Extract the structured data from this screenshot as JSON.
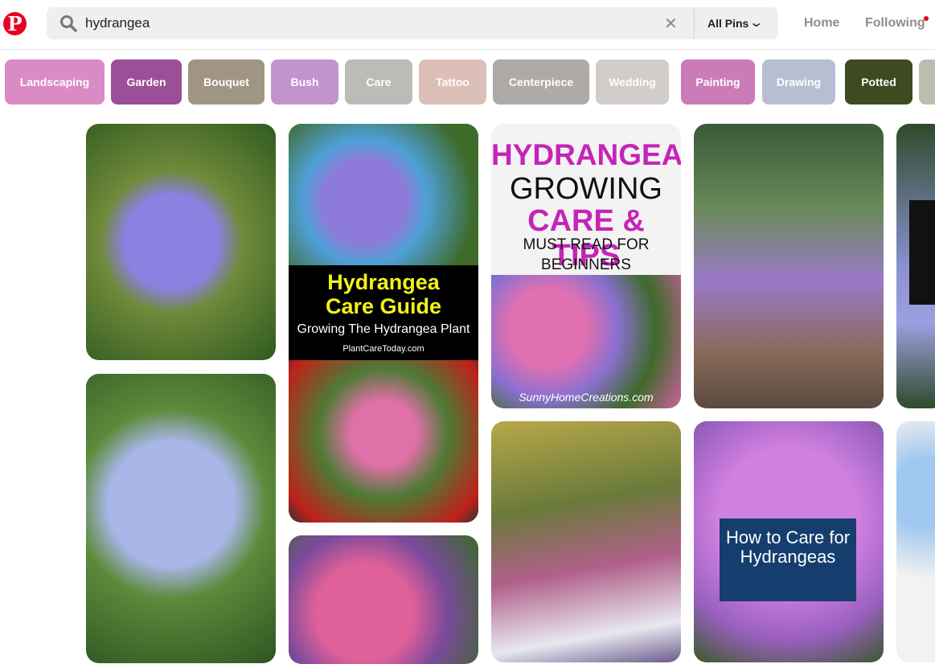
{
  "header": {
    "search_value": "hydrangea",
    "scope_label": "All Pins",
    "nav": [
      "Home",
      "Following"
    ]
  },
  "chips": [
    {
      "label": "Landscaping",
      "color": "#da8bc3"
    },
    {
      "label": "Garden",
      "color": "#9b4f97"
    },
    {
      "label": "Bouquet",
      "color": "#a09482"
    },
    {
      "label": "Bush",
      "color": "#c293cf"
    },
    {
      "label": "Care",
      "color": "#bcbbb8"
    },
    {
      "label": "Tattoo",
      "color": "#dcbfb7"
    },
    {
      "label": "Centerpiece",
      "color": "#aeaaa8"
    },
    {
      "label": "Wedding",
      "color": "#d2ccca"
    },
    {
      "label": "Painting",
      "color": "#cb7bb7"
    },
    {
      "label": "Drawing",
      "color": "#b6bfd2"
    },
    {
      "label": "Potted",
      "color": "#3e4a1f"
    },
    {
      "label": "",
      "color": "#b8bfae"
    }
  ],
  "pins": {
    "care_guide": {
      "title": "Hydrangea Care Guide",
      "subtitle": "Growing The Hydrangea Plant",
      "source": "PlantCareToday.com"
    },
    "growing": {
      "line1": "HYDRANGEA",
      "line2": "GROWING",
      "line3": "CARE & TIPS",
      "line4": "MUST READ FOR",
      "line5": "BEGINNERS",
      "source": "SunnyHomeCreations.com"
    },
    "how_to": {
      "title": "How to Care for Hydrangeas"
    }
  }
}
